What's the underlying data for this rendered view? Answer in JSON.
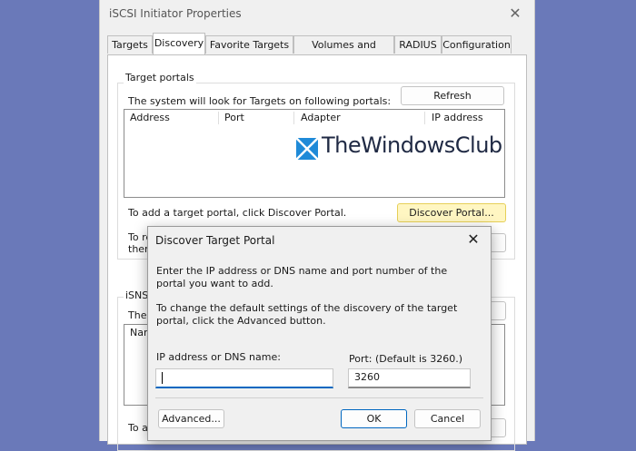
{
  "window": {
    "title": "iSCSI Initiator Properties",
    "close_glyph": "✕",
    "tabs": [
      {
        "label": "Targets"
      },
      {
        "label": "Discovery"
      },
      {
        "label": "Favorite Targets"
      },
      {
        "label": "Volumes and Devices"
      },
      {
        "label": "RADIUS"
      },
      {
        "label": "Configuration"
      }
    ],
    "active_tab": "Discovery"
  },
  "target_portals": {
    "group_label": "Target portals",
    "description": "The system will look for Targets on following portals:",
    "refresh_label": "Refresh",
    "columns": [
      "Address",
      "Port",
      "Adapter",
      "IP address"
    ],
    "add_hint": "To add a target portal, click Discover Portal.",
    "discover_label": "Discover Portal...",
    "remove_hint_fragment": "To re",
    "remove_hint_fragment2": "then"
  },
  "isns": {
    "group_label": "iSNS se",
    "desc_fragment": "The",
    "col_fragment": "Nam",
    "add_fragment": "To a"
  },
  "watermark": {
    "text": "TheWindowsClub"
  },
  "dialog": {
    "title": "Discover Target Portal",
    "close_glyph": "✕",
    "intro": "Enter the IP address or DNS name and port number of the portal you want to add.",
    "advanced_hint": "To change the default settings of the discovery of the target portal, click the Advanced button.",
    "ip_label": "IP address or DNS name:",
    "ip_value": "",
    "port_label": "Port: (Default is 3260.)",
    "port_value": "3260",
    "advanced_label": "Advanced...",
    "ok_label": "OK",
    "cancel_label": "Cancel"
  },
  "colors": {
    "accent": "#0067c0",
    "highlight": "#fff6c2",
    "background": "#6a79b9"
  }
}
